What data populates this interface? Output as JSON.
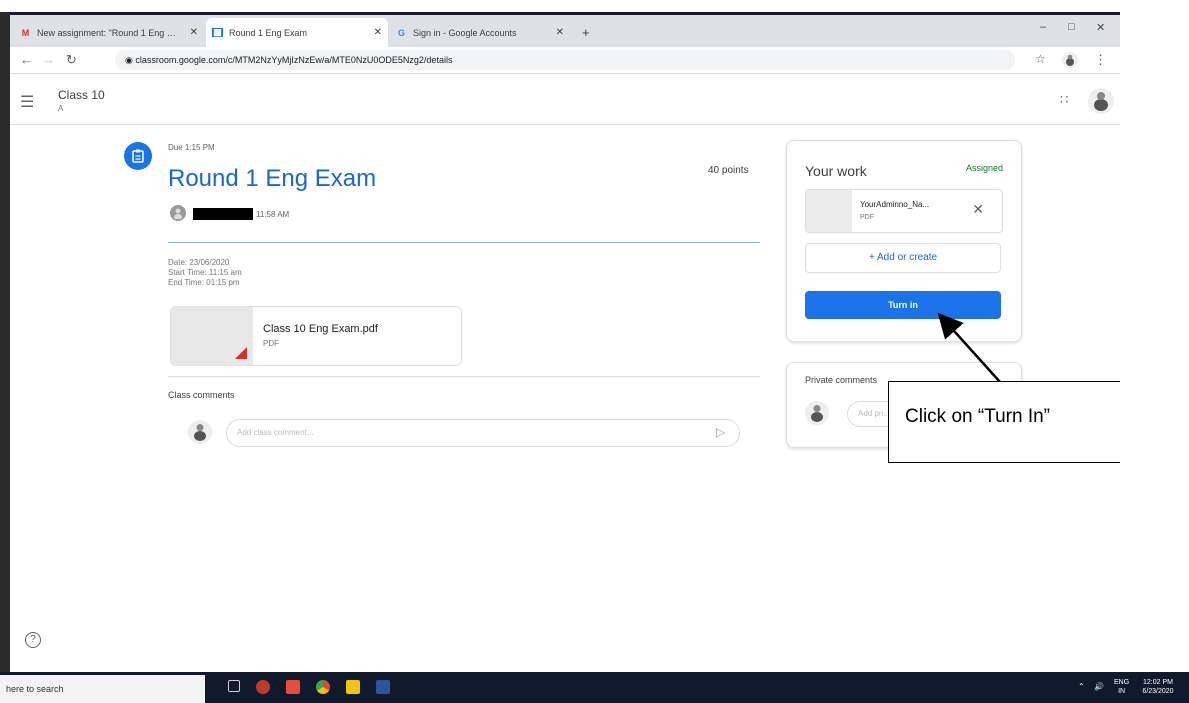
{
  "browser": {
    "tabs": [
      {
        "favicon": "gmail-icon",
        "label": "New assignment: \"Round 1 Eng …",
        "close": "✕"
      },
      {
        "favicon": "classroom-icon",
        "label": "Round 1 Eng Exam",
        "close": "✕"
      },
      {
        "favicon": "google-icon",
        "label": "Sign in - Google Accounts",
        "close": "✕"
      }
    ],
    "new_tab": "+",
    "url": "classroom.google.com/c/MTM2NzYyMjIzNzEw/a/MTE0NzU0ODE5Nzg2/details",
    "window_controls": {
      "minimize": "–",
      "maximize": "□",
      "close": "✕"
    }
  },
  "header": {
    "class_name": "Class 10",
    "section": "A"
  },
  "assignment": {
    "due": "Due 1:15 PM",
    "title": "Round 1 Eng Exam",
    "points": "40 points",
    "posted_time": "11:58 AM",
    "description": [
      "Date: 23/06/2020",
      "Start Time: 11:15 am",
      "End Time: 01:15 pm"
    ],
    "attachment": {
      "name": "Class 10 Eng Exam.pdf",
      "type": "PDF"
    }
  },
  "comments": {
    "heading": "Class comments",
    "placeholder": "Add class comment..."
  },
  "your_work": {
    "heading": "Your work",
    "status": "Assigned",
    "file_name": "YourAdminno_Na...",
    "file_type": "PDF",
    "add_label": "+ Add or create",
    "turn_in_label": "Turn in"
  },
  "private": {
    "heading": "Private comments",
    "placeholder": "Add pri..."
  },
  "callout": {
    "text": "Click on “Turn In”"
  },
  "taskbar": {
    "search": "here to search",
    "lang": "ENG",
    "region": "IN",
    "time": "12:02 PM",
    "date": "6/23/2020"
  },
  "colors": {
    "accent": "#1a73e8",
    "title": "#1967d2",
    "assigned": "#137333"
  }
}
